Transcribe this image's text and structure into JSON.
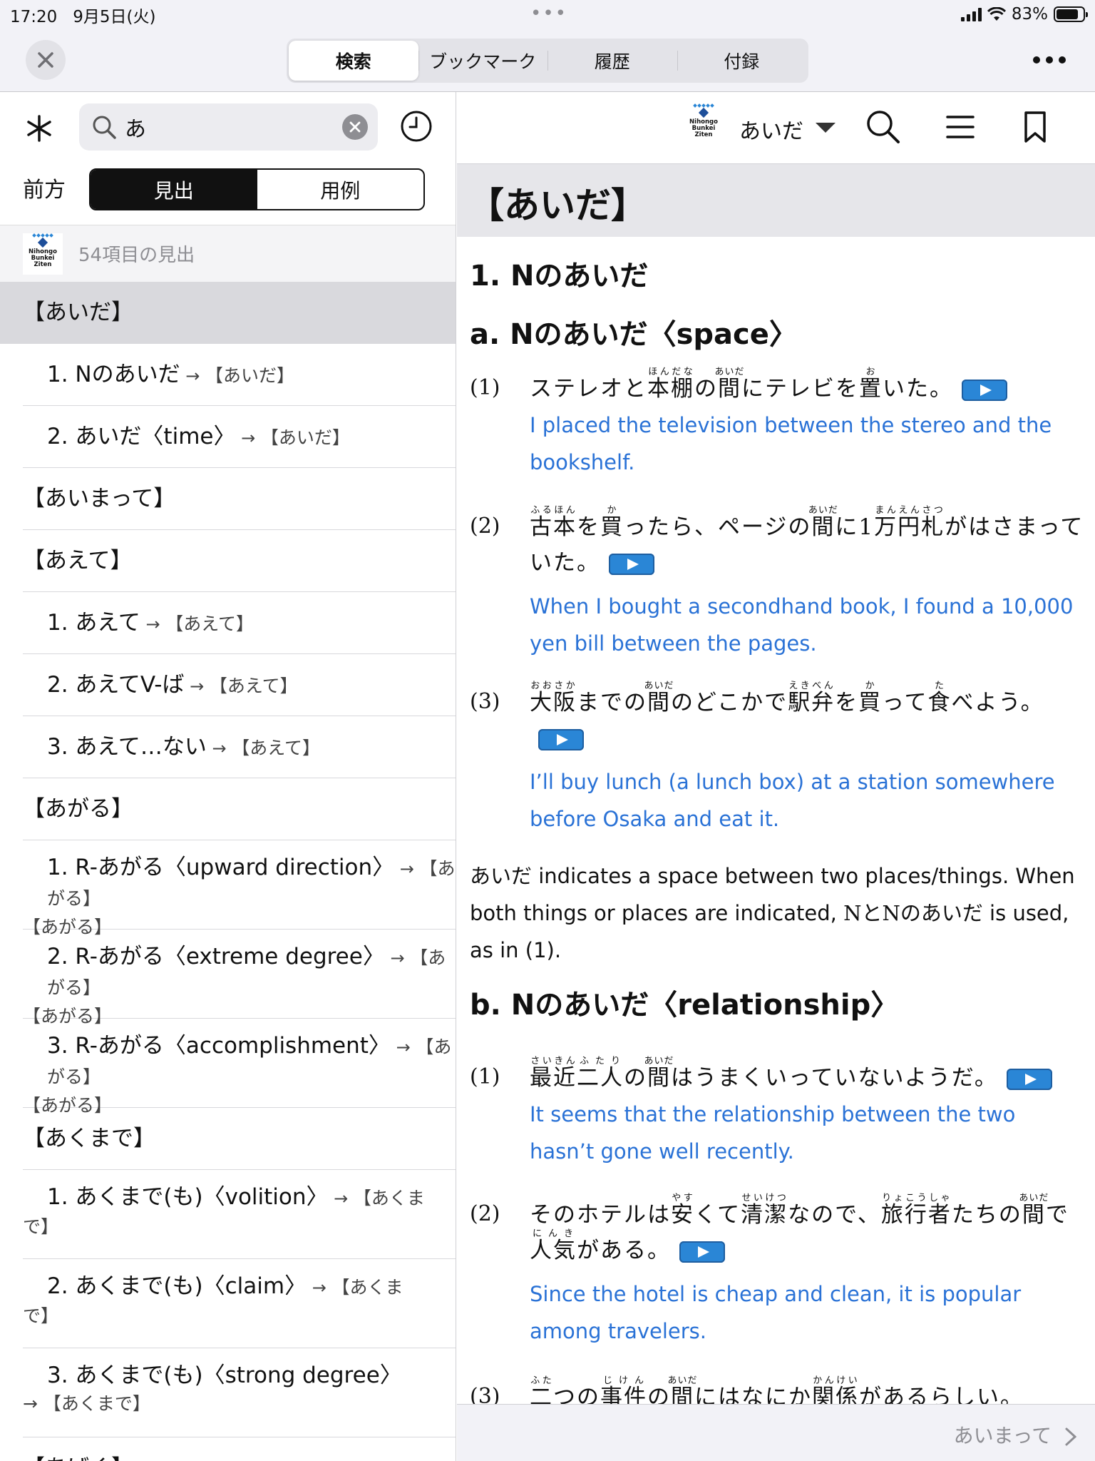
{
  "status_bar": {
    "time": "17:20",
    "date": "9月5日(火)",
    "battery": "83%",
    "battery_level": 0.83
  },
  "top_nav": {
    "tabs": [
      {
        "label": "検索",
        "active": true
      },
      {
        "label": "ブックマーク",
        "active": false
      },
      {
        "label": "履歴",
        "active": false
      },
      {
        "label": "付録",
        "active": false
      }
    ]
  },
  "search": {
    "query": "あ",
    "direction_label": "前方",
    "modes": [
      "見出",
      "用例"
    ],
    "active_mode": "見出"
  },
  "logo": {
    "lines": [
      "Nihongo",
      "Bunkei",
      "Ziten"
    ]
  },
  "results": {
    "count_text": "54項目の見出",
    "items": [
      {
        "type": "head",
        "text": "【あいだ】",
        "selected": true
      },
      {
        "type": "sub",
        "text": "1. Nのあいだ",
        "ref": "【あいだ】"
      },
      {
        "type": "sub",
        "text": "2. あいだ〈time〉",
        "ref": "【あいだ】"
      },
      {
        "type": "head",
        "text": "【あいまって】"
      },
      {
        "type": "head",
        "text": "【あえて】"
      },
      {
        "type": "sub",
        "text": "1. あえて",
        "ref": "【あえて】"
      },
      {
        "type": "sub",
        "text": "2. あえてV-ば",
        "ref": "【あえて】"
      },
      {
        "type": "sub",
        "text": "3. あえて…ない",
        "ref": "【あえて】"
      },
      {
        "type": "head",
        "text": "【あがる】"
      },
      {
        "type": "sub2",
        "text": "1. R-あがる〈upward direction〉",
        "ref": "【あがる】"
      },
      {
        "type": "sub2",
        "text": "2. R-あがる〈extreme degree〉",
        "ref": "【あがる】"
      },
      {
        "type": "sub2",
        "text": "3. R-あがる〈accomplishment〉",
        "ref": "【あがる】"
      },
      {
        "type": "head",
        "text": "【あくまで】"
      },
      {
        "type": "sub2",
        "text": "1. あくまで(も)〈volition〉",
        "ref": "【あくま",
        "ref_tail": "で】"
      },
      {
        "type": "sub2",
        "text": "2. あくまで(も)〈claim〉",
        "ref": "【あくま",
        "ref_tail": "で】"
      },
      {
        "type": "sub2",
        "text": "3. あくまで(も)〈strong degree〉",
        "ref": "",
        "ref_tail": "【あくまで】"
      },
      {
        "type": "head",
        "text": "【あげく】"
      }
    ]
  },
  "dictionary": {
    "current_entry": "あいだ",
    "entry_title": "【あいだ】",
    "section_1": "1.  Nのあいだ",
    "sub_a": "a.  Nのあいだ〈space〉",
    "sub_b": "b.  Nのあいだ〈relationship〉",
    "examples_a": [
      {
        "num": "(1)",
        "en": "I placed the television between the stereo and the bookshelf."
      },
      {
        "num": "(2)",
        "en": "When I bought a secondhand book, I found a 10,000 yen bill between the pages."
      },
      {
        "num": "(3)",
        "en": "I’ll buy lunch (a lunch box) at a station somewhere before Osaka and eat it."
      }
    ],
    "explanation": {
      "jp1": "あいだ",
      "t1": " indicates a space between two places/things. When both things or places are indicated, ",
      "jp2": "NとNのあいだ",
      "t2": " is used, as in (1)."
    },
    "examples_b": [
      {
        "num": "(1)",
        "en": "It seems that the relationship between the two hasn’t gone well recently."
      },
      {
        "num": "(2)",
        "en": "Since the hotel is cheap and clean, it is popular among travelers."
      },
      {
        "num": "(3)"
      }
    ],
    "next_entry": "あいまって"
  },
  "icons": [
    "close-icon",
    "more-icon",
    "asterisk-icon",
    "search-icon",
    "clear-icon",
    "history-clock-icon",
    "chevron-down-icon",
    "menu-icon",
    "bookmark-icon",
    "play-icon",
    "chevron-right-icon"
  ]
}
